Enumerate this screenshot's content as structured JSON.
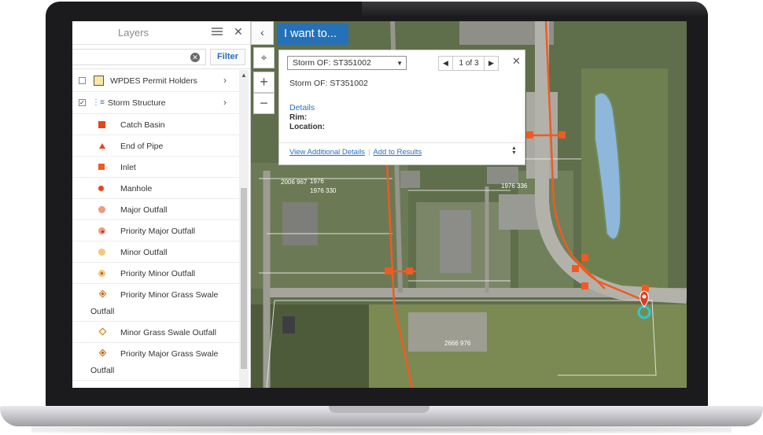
{
  "layers_panel": {
    "title": "Layers",
    "search": {
      "value": "",
      "placeholder": ""
    },
    "filter_label": "Filter",
    "layers": [
      {
        "label": "WPDES Permit Holders",
        "checked": false
      },
      {
        "label": "Storm Structure",
        "checked": true
      }
    ],
    "legend": [
      {
        "label": "Catch Basin",
        "symbol": "square"
      },
      {
        "label": "End of Pipe",
        "symbol": "triangle"
      },
      {
        "label": "Inlet",
        "symbol": "inlet"
      },
      {
        "label": "Manhole",
        "symbol": "dot"
      },
      {
        "label": "Major Outfall",
        "symbol": "major"
      },
      {
        "label": "Priority Major Outfall",
        "symbol": "priomajor"
      },
      {
        "label": "Minor Outfall",
        "symbol": "minor"
      },
      {
        "label": "Priority Minor Outfall",
        "symbol": "priominor"
      },
      {
        "label": "Priority Minor Grass Swale",
        "label_cont": "Outfall",
        "symbol": "diamond-prio"
      },
      {
        "label": "Minor Grass Swale Outfall",
        "symbol": "diamond"
      },
      {
        "label": "Priority Major Grass Swale",
        "label_cont": "Outfall",
        "symbol": "diamond-prio"
      }
    ]
  },
  "toolbar": {
    "i_want_to": "I want to..."
  },
  "popup": {
    "selected_feature": "Storm OF: ST351002",
    "pager": "1 of 3",
    "title": "Storm OF: ST351002",
    "details_link": "Details",
    "fields": [
      "Rim:",
      "Location:"
    ],
    "actions": [
      "View Additional Details",
      "Add to Results"
    ]
  },
  "map": {
    "parcel_labels": [
      "1976 336",
      "2666 976",
      "1976",
      "2006 967",
      "1976 330"
    ],
    "pipe_color": "#f15a22",
    "accent_color": "#2471b8"
  }
}
